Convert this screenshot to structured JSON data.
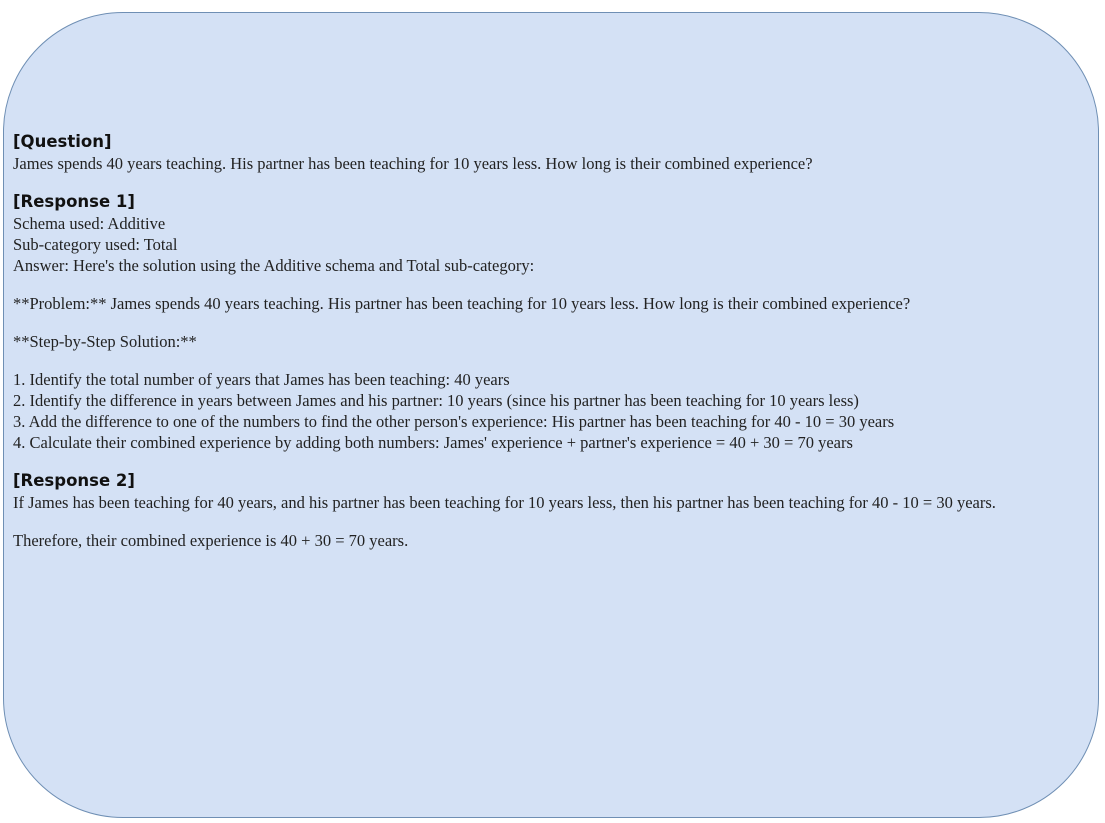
{
  "question": {
    "heading": "[Question]",
    "text": "James spends 40 years teaching. His partner has been teaching for 10 years less. How long is their combined experience?"
  },
  "response1": {
    "heading": "[Response 1]",
    "schema": "Schema used: Additive",
    "subcategory": "Sub-category used: Total",
    "answer": "Answer: Here's the solution using the Additive schema and Total sub-category:",
    "problem": "**Problem:** James spends 40 years teaching. His partner has been teaching for 10 years less. How long is their combined experience?",
    "solution_heading": "**Step-by-Step Solution:**",
    "steps": [
      "1. Identify the total number of years that James has been teaching: 40 years",
      "2. Identify the difference in years between James and his partner: 10 years (since his partner has been teaching for 10 years less)",
      "3. Add the difference to one of the numbers to find the other person's experience: His partner has been teaching for 40 - 10 = 30 years",
      "4. Calculate their combined experience by adding both numbers: James' experience + partner's experience = 40 + 30 = 70 years"
    ]
  },
  "response2": {
    "heading": "[Response 2]",
    "paragraph1": "If James has been teaching for 40 years, and his partner has been teaching for 10 years less, then his partner has been teaching for 40 - 10 = 30 years.",
    "paragraph2": "Therefore, their combined experience is 40 + 30 = 70 years."
  }
}
